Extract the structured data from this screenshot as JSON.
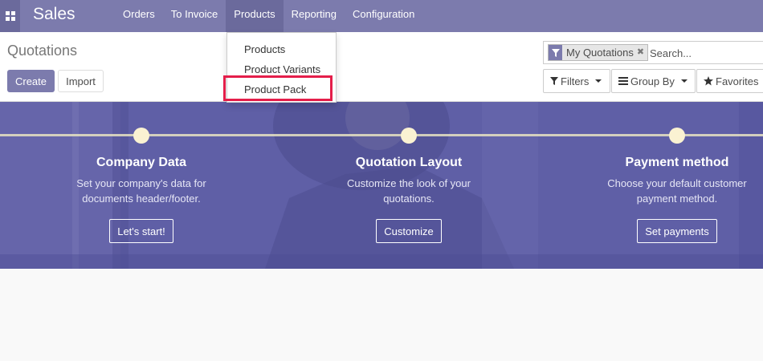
{
  "navbar": {
    "brand": "Sales",
    "menu": [
      "Orders",
      "To Invoice",
      "Products",
      "Reporting",
      "Configuration"
    ],
    "active_index": 2
  },
  "control_panel": {
    "title": "Quotations",
    "create_label": "Create",
    "import_label": "Import",
    "search": {
      "facet": "My Quotations",
      "placeholder": "Search..."
    },
    "filters_label": "Filters",
    "groupby_label": "Group By",
    "favorites_label": "Favorites"
  },
  "products_dropdown": {
    "items": [
      "Products",
      "Product Variants",
      "Product Pack"
    ],
    "highlighted": "Product Pack"
  },
  "onboarding": {
    "steps": [
      {
        "title": "Company Data",
        "desc_line1": "Set your company's data for",
        "desc_line2": "documents header/footer.",
        "button": "Let's start!"
      },
      {
        "title": "Quotation Layout",
        "desc_line1": "Customize the look of your",
        "desc_line2": "quotations.",
        "button": "Customize"
      },
      {
        "title": "Payment method",
        "desc_line1": "Choose your default customer",
        "desc_line2": "payment method.",
        "button": "Set payments"
      }
    ]
  },
  "colors": {
    "navbar": "#7c7bad",
    "banner": "#5f5fa6",
    "highlight_border": "#e41e4a",
    "timeline_dot": "#faf2d2"
  }
}
